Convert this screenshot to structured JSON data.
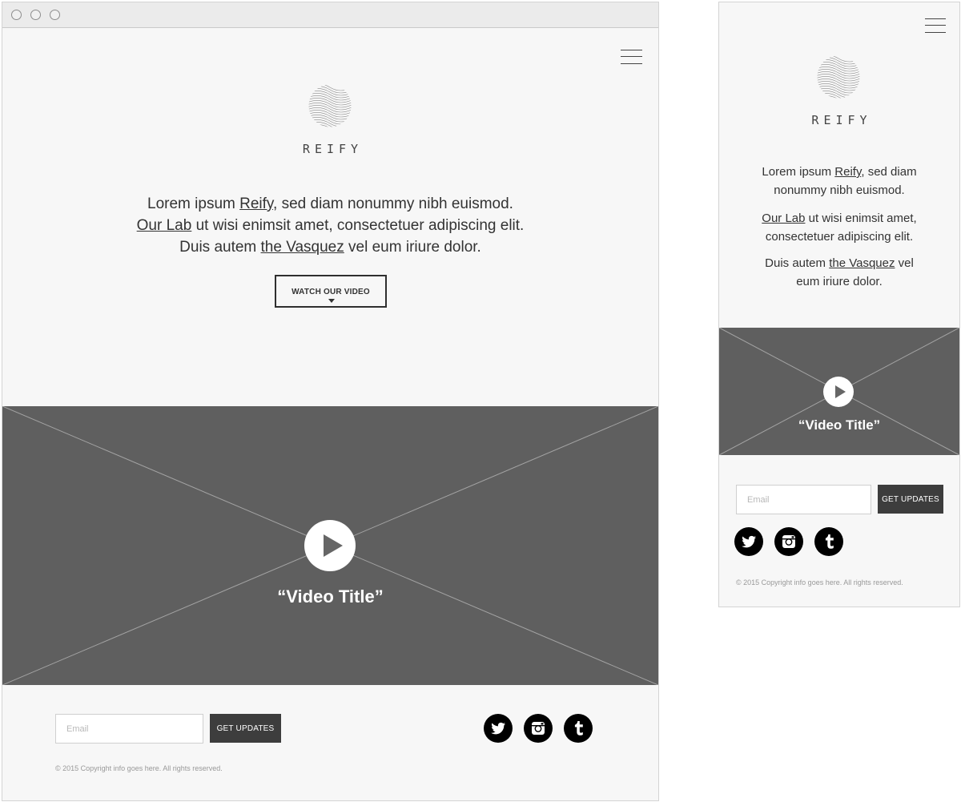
{
  "desktop": {
    "brand": "REIFY",
    "lede": {
      "line1_pre": "Lorem ipsum ",
      "line1_link": "Reify",
      "line1_post": ", sed diam nonummy nibh euismod.",
      "line2_link": "Our Lab",
      "line2_post": " ut wisi enimsit amet, consectetuer adipiscing elit.",
      "line3_pre": "Duis autem ",
      "line3_link": "the Vasquez",
      "line3_post": " vel eum iriure dolor."
    },
    "watch_button": "WATCH OUR VIDEO",
    "video_title": "“Video Title”",
    "email_placeholder": "Email",
    "get_updates": "GET UPDATES",
    "copyright": "© 2015 Copyright info goes here. All rights reserved."
  },
  "mobile": {
    "brand": "REIFY",
    "lede": {
      "p1_pre": "Lorem ipsum ",
      "p1_link": "Reify",
      "p1_post": ", sed diam nonummy nibh euismod.",
      "p2_link": "Our Lab",
      "p2_post": " ut wisi enimsit amet, consectetuer adipiscing elit.",
      "p3_pre": "Duis autem ",
      "p3_link": "the Vasquez",
      "p3_post": " vel eum iriure dolor."
    },
    "video_title": "“Video Title”",
    "email_placeholder": "Email",
    "get_updates": "GET UPDATES",
    "copyright": "© 2015 Copyright info goes here. All rights reserved."
  },
  "icons": {
    "menu": "hamburger-icon",
    "logo": "wave-sphere-logo-icon",
    "play": "play-icon",
    "twitter": "twitter-icon",
    "instagram": "instagram-icon",
    "tumblr": "tumblr-icon"
  },
  "colors": {
    "page_bg": "#f7f7f7",
    "video_bg": "#5f5f5f",
    "button_dark": "#3d3d3d",
    "social_bg": "#000000"
  }
}
